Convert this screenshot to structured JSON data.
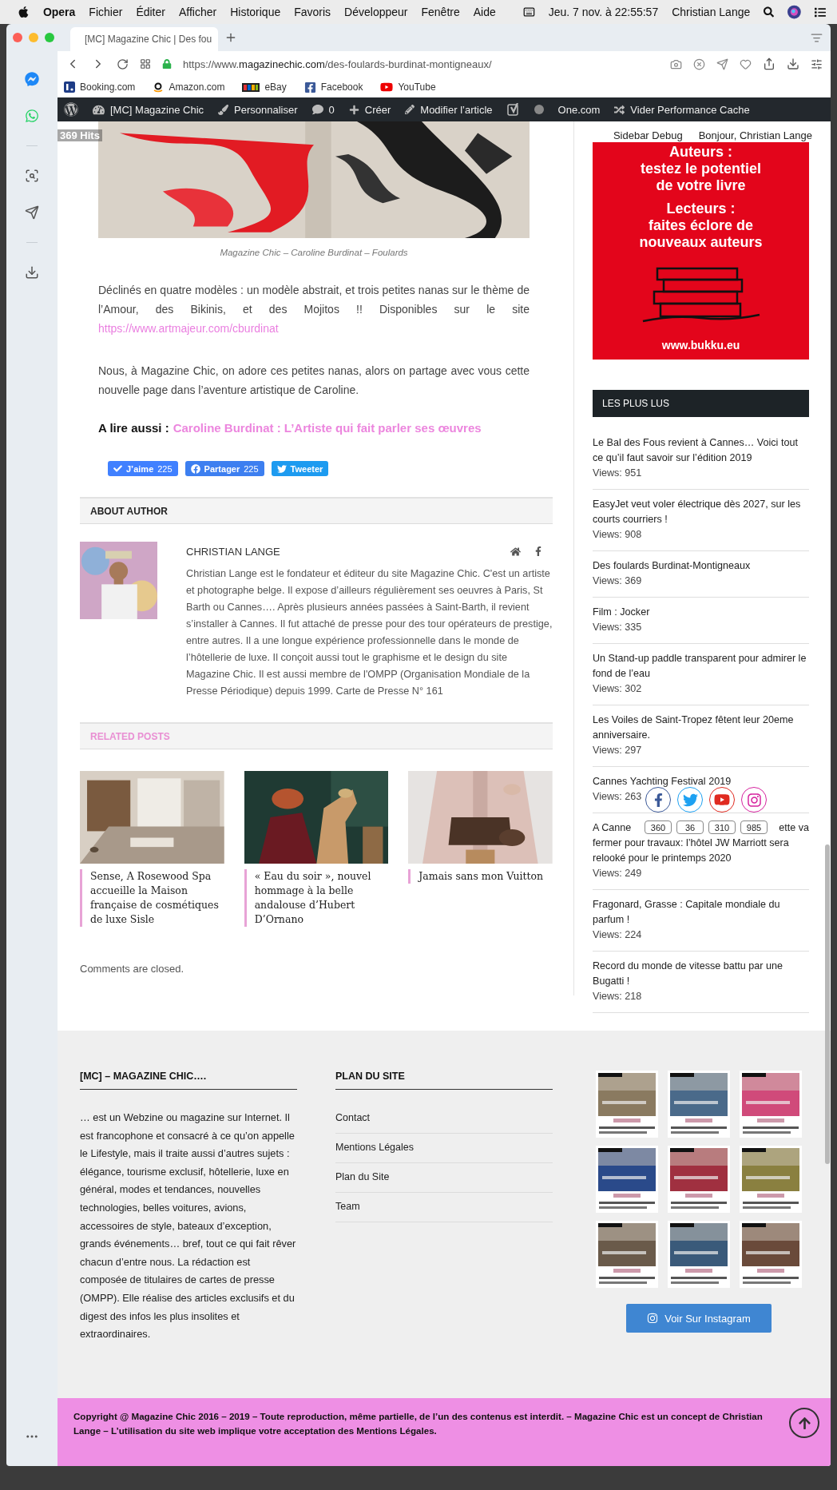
{
  "menu_bar": {
    "app": "Opera",
    "menus": [
      "Fichier",
      "Éditer",
      "Afficher",
      "Historique",
      "Favoris",
      "Développeur",
      "Fenêtre",
      "Aide"
    ],
    "clock": "Jeu. 7 nov. à  22:55:57",
    "user": "Christian Lange"
  },
  "browser": {
    "tabs": [
      {
        "title": "[MC] Magazine Chic | Des fou",
        "selected": true
      }
    ],
    "url": {
      "scheme": "https://www.",
      "host": "magazinechic.com",
      "path": "/des-foulards-burdinat-montigneaux/"
    },
    "bookmarks": [
      {
        "label": "Booking.com",
        "kind": "booking"
      },
      {
        "label": "Amazon.com",
        "kind": "amazon"
      },
      {
        "label": "eBay",
        "kind": "ebay"
      },
      {
        "label": "Facebook",
        "kind": "facebook"
      },
      {
        "label": "YouTube",
        "kind": "youtube"
      }
    ]
  },
  "admin_bar": {
    "items": [
      {
        "kind": "wordpress"
      },
      {
        "kind": "dashboard",
        "label": "[MC] Magazine Chic"
      },
      {
        "kind": "brush",
        "label": "Personnaliser"
      },
      {
        "kind": "comment",
        "label": "0"
      },
      {
        "kind": "plus",
        "label": "Créer"
      },
      {
        "kind": "pencil",
        "label": "Modifier l’article"
      },
      {
        "kind": "yoast"
      },
      {
        "kind": "dot"
      },
      {
        "kind": "text",
        "label": "One.com"
      },
      {
        "kind": "shuffle",
        "label": "Vider Performance Cache"
      }
    ]
  },
  "debug_overlay": {
    "hits": "369 Hits",
    "debug": "Sidebar Debug",
    "greeting": "Bonjour, Christian Lange"
  },
  "article": {
    "caption": "Magazine Chic – Caroline Burdinat – Foulards",
    "paragraphs": [
      {
        "text": "Déclinés en quatre modèles : un modèle abstrait, et trois petites nanas sur le thème de l’Amour, des Bikinis, et des Mojitos !! Disponibles sur le site",
        "link": "https://www.artmajeur.com/cburdinat"
      },
      {
        "text": "Nous, à Magazine Chic, on adore ces petites nanas, alors on partage avec vous cette nouvelle page dans l’aventure artistique de Caroline."
      }
    ],
    "read_also": {
      "label": "A lire aussi :",
      "link": "Caroline Burdinat : L’Artiste qui fait parler ses œuvres"
    },
    "share_buttons": [
      {
        "kind": "like",
        "label": "J’aime",
        "count": "225"
      },
      {
        "kind": "share",
        "label": "Partager",
        "count": "225"
      },
      {
        "kind": "tweet",
        "label": "Tweeter"
      }
    ],
    "about_author": {
      "heading": "ABOUT AUTHOR",
      "name": "CHRISTIAN LANGE",
      "bio": "Christian Lange est le fondateur et éditeur du site Magazine Chic. C'est un artiste et photographe belge. Il expose d’ailleurs régulièrement ses oeuvres à Paris, St Barth ou Cannes…. Après plusieurs années passées à Saint-Barth, il revient s’installer à Cannes. Il fut attaché de presse pour des tour opérateurs de prestige, entre autres. Il a une longue expérience professionnelle dans le monde de l’hôtellerie de luxe. Il conçoit aussi tout le graphisme et le design du site Magazine Chic. Il est aussi membre de l'OMPP (Organisation Mondiale de la Presse Périodique) depuis 1999. Carte de Presse N° 161"
    },
    "related_posts": {
      "heading": "RELATED POSTS",
      "posts": [
        {
          "title": "Sense, A Rosewood Spa accueille la Maison française de cosmétiques de luxe Sisle"
        },
        {
          "title": "« Eau du soir », nouvel hommage à la belle andalouse d’Hubert D’Ornano"
        },
        {
          "title": "Jamais sans mon Vuitton"
        }
      ]
    },
    "comments_note": "Comments are closed."
  },
  "sidebar": {
    "ad": {
      "lines": [
        "Auteurs :",
        "testez le potentiel",
        "de votre livre",
        "Lecteurs :",
        "faites éclore de",
        "nouveaux auteurs"
      ],
      "url": "www.bukku.eu"
    },
    "most_read": {
      "heading": "LES PLUS LUS",
      "items": [
        {
          "title": "Le Bal des Fous revient à Cannes… Voici tout ce qu’il faut savoir sur l’édition 2019",
          "views": "Views: 951"
        },
        {
          "title": "EasyJet veut voler électrique dès 2027, sur les courts courriers !",
          "views": "Views: 908"
        },
        {
          "title": "Des foulards Burdinat-Montigneaux",
          "views": "Views: 369"
        },
        {
          "title": "Film : Jocker",
          "views": "Views: 335"
        },
        {
          "title": "Un Stand-up paddle transparent pour admirer le fond de l’eau",
          "views": "Views: 302"
        },
        {
          "title": "Les Voiles de Saint-Tropez fêtent leur 20eme anniversaire.",
          "views": "Views: 297"
        },
        {
          "title": "Cannes Yachting Festival 2019",
          "views": "Views: 263"
        },
        {
          "title": "A Canne",
          "title_after_overlay": "ette va",
          "title_continued": "fermer pour travaux: l’hôtel JW Marriott sera relooké pour le printemps 2020",
          "views": "Views: 249"
        },
        {
          "title": "Fragonard, Grasse : Capitale mondiale du parfum !",
          "views": "Views: 224"
        },
        {
          "title": "Record du monde de vitesse battu par une Bugatti !",
          "views": "Views: 218"
        }
      ]
    }
  },
  "social_follow": [
    {
      "kind": "facebook",
      "count": "360"
    },
    {
      "kind": "twitter",
      "count": "36"
    },
    {
      "kind": "youtube",
      "count": "310"
    },
    {
      "kind": "instagram",
      "count": "985"
    }
  ],
  "footer": {
    "about": {
      "heading": "[MC] – MAGAZINE CHIC….",
      "text": "… est un Webzine ou magazine sur Internet. Il est francophone et consacré à ce qu’on appelle le Lifestyle, mais il traite aussi d’autres sujets : élégance, tourisme exclusif, hôtellerie, luxe en général, modes et tendances, nouvelles technologies, belles voitures, avions, accessoires de style, bateaux d’exception, grands événements… bref, tout ce qui fait rêver chacun d’entre nous. La rédaction est composée de titulaires de cartes de presse (OMPP). Elle réalise des articles exclusifs et du digest des infos les plus insolites et extraordinaires."
    },
    "sitemap": {
      "heading": "PLAN DU SITE",
      "links": [
        "Contact",
        "Mentions Légales",
        "Plan du Site",
        "Team"
      ]
    },
    "instagram": {
      "button": "Voir Sur Instagram"
    }
  },
  "copyright": "Copyright @ Magazine Chic 2016 – 2019 – Toute reproduction, même partielle, de l’un des contenus est interdit. – Magazine Chic est un concept de Christian Lange – L’utilisation du site web implique votre acceptation des Mentions Légales."
}
